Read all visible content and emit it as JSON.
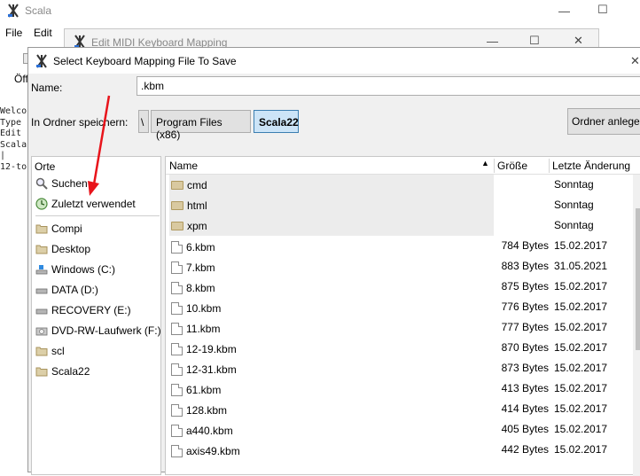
{
  "main_window": {
    "title": "Scala",
    "menu": [
      "File",
      "Edit"
    ],
    "toolbar_fragment": "Öff",
    "console_lines": [
      "Welco",
      "Type",
      "Edit",
      "Scala",
      "|",
      "12-to"
    ]
  },
  "edit_window": {
    "title": "Edit MIDI Keyboard Mapping"
  },
  "dialog": {
    "title": "Select Keyboard Mapping File To Save",
    "name_label": "Name:",
    "name_value": ".kbm",
    "folder_label": "In Ordner speichern:",
    "breadcrumb": [
      "\\",
      "Program Files (x86)",
      "Scala22"
    ],
    "new_folder_button": "Ordner anlegen",
    "places_header": "Orte",
    "places": [
      {
        "label": "Suchen",
        "icon": "search-icon"
      },
      {
        "label": "Zuletzt verwendet",
        "icon": "recent-icon"
      },
      {
        "label": "Compi",
        "icon": "folder-icon"
      },
      {
        "label": "Desktop",
        "icon": "folder-icon"
      },
      {
        "label": "Windows (C:)",
        "icon": "windows-drive-icon"
      },
      {
        "label": "DATA (D:)",
        "icon": "drive-icon"
      },
      {
        "label": "RECOVERY (E:)",
        "icon": "drive-icon"
      },
      {
        "label": "DVD-RW-Laufwerk (F:)",
        "icon": "optical-drive-icon"
      },
      {
        "label": "scl",
        "icon": "folder-icon"
      },
      {
        "label": "Scala22",
        "icon": "folder-icon"
      }
    ],
    "columns": {
      "name": "Name",
      "size": "Größe",
      "date": "Letzte Änderung"
    },
    "files": [
      {
        "name": "cmd",
        "size": "",
        "date": "Sonntag",
        "type": "folder"
      },
      {
        "name": "html",
        "size": "",
        "date": "Sonntag",
        "type": "folder"
      },
      {
        "name": "xpm",
        "size": "",
        "date": "Sonntag",
        "type": "folder"
      },
      {
        "name": "6.kbm",
        "size": "784 Bytes",
        "date": "15.02.2017",
        "type": "file"
      },
      {
        "name": "7.kbm",
        "size": "883 Bytes",
        "date": "31.05.2021",
        "type": "file"
      },
      {
        "name": "8.kbm",
        "size": "875 Bytes",
        "date": "15.02.2017",
        "type": "file"
      },
      {
        "name": "10.kbm",
        "size": "776 Bytes",
        "date": "15.02.2017",
        "type": "file"
      },
      {
        "name": "11.kbm",
        "size": "777 Bytes",
        "date": "15.02.2017",
        "type": "file"
      },
      {
        "name": "12-19.kbm",
        "size": "870 Bytes",
        "date": "15.02.2017",
        "type": "file"
      },
      {
        "name": "12-31.kbm",
        "size": "873 Bytes",
        "date": "15.02.2017",
        "type": "file"
      },
      {
        "name": "61.kbm",
        "size": "413 Bytes",
        "date": "15.02.2017",
        "type": "file"
      },
      {
        "name": "128.kbm",
        "size": "414 Bytes",
        "date": "15.02.2017",
        "type": "file"
      },
      {
        "name": "a440.kbm",
        "size": "405 Bytes",
        "date": "15.02.2017",
        "type": "file"
      },
      {
        "name": "axis49.kbm",
        "size": "442 Bytes",
        "date": "15.02.2017",
        "type": "file"
      }
    ],
    "annotation_arrow_color": "#e8141b"
  }
}
